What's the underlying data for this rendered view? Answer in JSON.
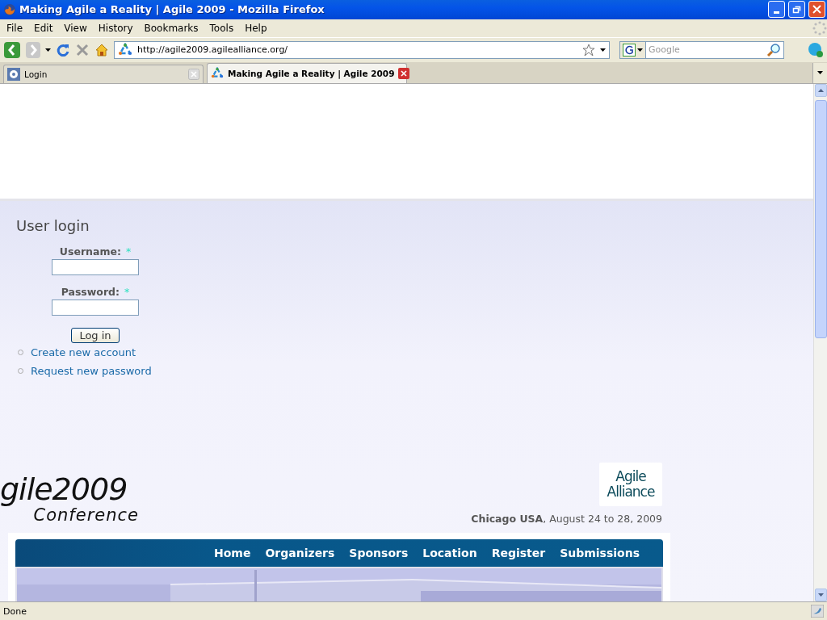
{
  "window": {
    "title": "Making Agile a Reality | Agile 2009 - Mozilla Firefox"
  },
  "menu": [
    {
      "label": "File"
    },
    {
      "label": "Edit"
    },
    {
      "label": "View"
    },
    {
      "label": "History"
    },
    {
      "label": "Bookmarks"
    },
    {
      "label": "Tools"
    },
    {
      "label": "Help"
    }
  ],
  "toolbar": {
    "url": "http://agile2009.agilealliance.org/",
    "search_placeholder": "Google"
  },
  "tabs": [
    {
      "label": "Login",
      "selected": false
    },
    {
      "label": "Making Agile a Reality | Agile 2009",
      "selected": true
    }
  ],
  "login": {
    "heading": "User login",
    "fields": [
      {
        "label": "Username:",
        "required_mark": "*"
      },
      {
        "label": "Password:",
        "required_mark": "*"
      }
    ],
    "button": "Log in",
    "links": [
      "Create new account",
      "Request new password"
    ]
  },
  "header": {
    "logo": "gile2009",
    "logo_sub": "Conference",
    "partner_logo": [
      "Agile",
      "Alliance"
    ],
    "tagline": "**Chicago USA**, August 24 to 28, 2009"
  },
  "nav": [
    "Home",
    "Organizers",
    "Sponsors",
    "Location",
    "Register",
    "Submissions"
  ],
  "status_bar": "Done"
}
